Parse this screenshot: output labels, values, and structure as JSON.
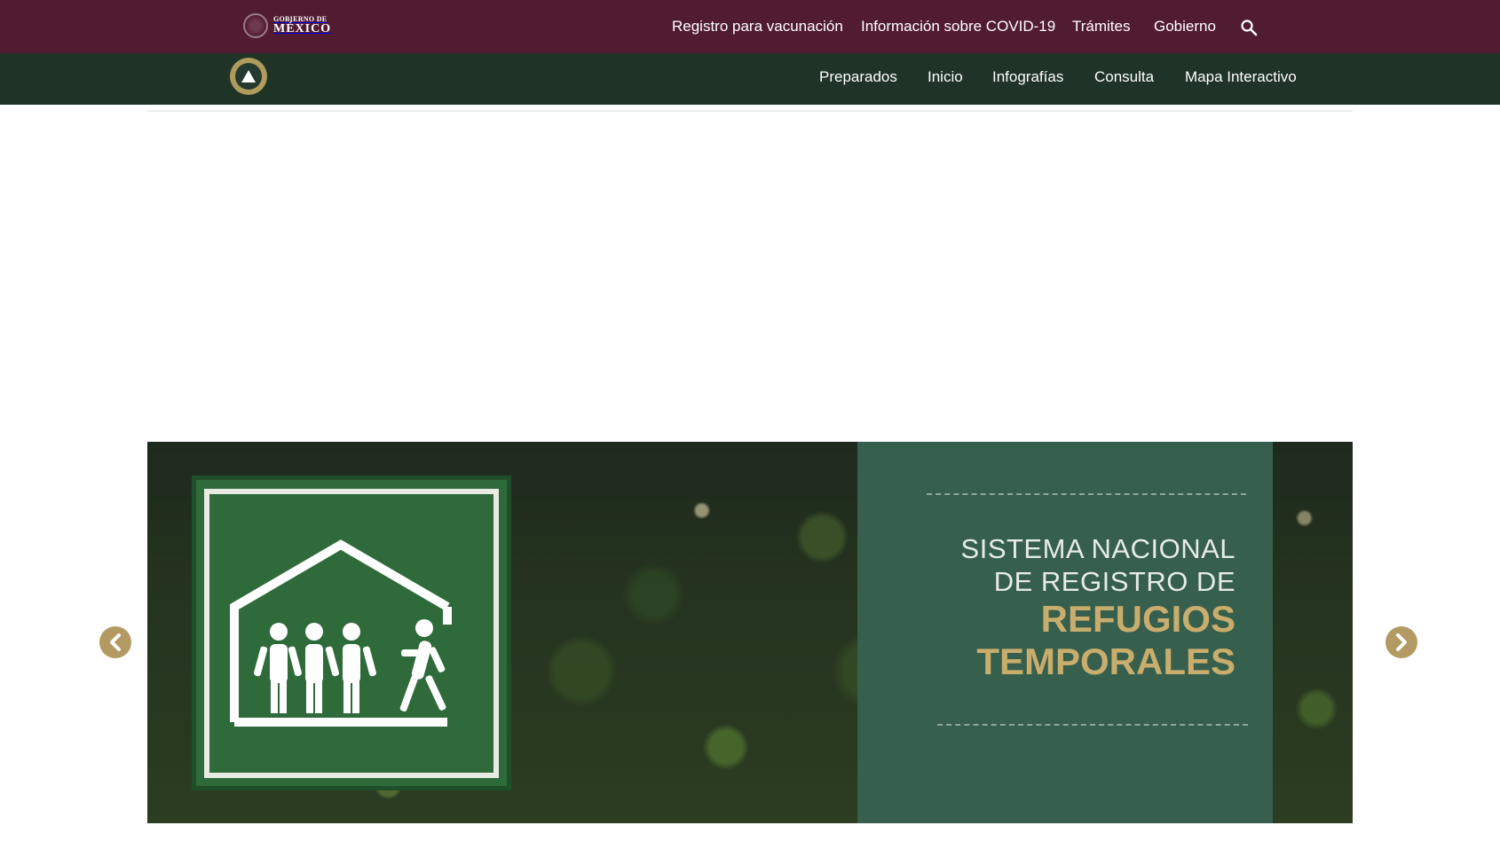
{
  "gov_bar": {
    "logo_small": "GOBIERNO DE",
    "logo_big": "MÉXICO",
    "links": [
      "Registro para vacunación",
      "Información sobre COVID-19",
      "Trámites",
      "Gobierno"
    ],
    "search_icon": "search-icon"
  },
  "site_nav": {
    "links": [
      "Preparados",
      "Inicio",
      "Infografías",
      "Consulta",
      "Mapa Interactivo"
    ]
  },
  "carousel": {
    "slide": {
      "line1": "SISTEMA NACIONAL",
      "line2": "DE REGISTRO DE",
      "line3": "REFUGIOS",
      "line4": "TEMPORALES"
    },
    "prev_icon": "chevron-left-icon",
    "next_icon": "chevron-right-icon"
  },
  "colors": {
    "gov_bar": "#511c31",
    "site_bar": "#1f3327",
    "accent_gold": "#c9ad6d",
    "panel_green": "#365f4d"
  }
}
